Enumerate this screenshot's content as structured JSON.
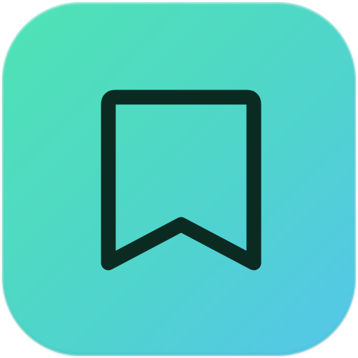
{
  "app_icon": {
    "icon": "bookmark-icon",
    "gradient_start": "#4fe3b4",
    "gradient_mid": "#4fd6c8",
    "gradient_end": "#55c6ea",
    "glyph_color": "#0b2a22"
  }
}
